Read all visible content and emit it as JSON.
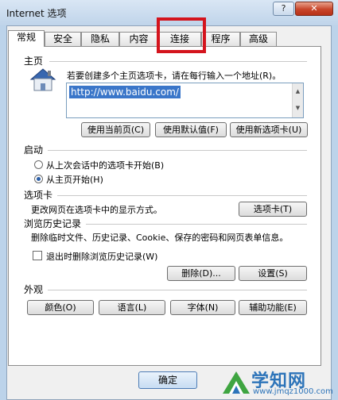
{
  "window": {
    "title": "Internet 选项",
    "help_label": "?",
    "close_label": "✕"
  },
  "tabs": [
    "常规",
    "安全",
    "隐私",
    "内容",
    "连接",
    "程序",
    "高级"
  ],
  "home": {
    "section": "主页",
    "desc": "若要创建多个主页选项卡，请在每行输入一个地址(R)。",
    "url": "http://www.baidu.com/",
    "btn_current": "使用当前页(C)",
    "btn_default": "使用默认值(F)",
    "btn_new_tab": "使用新选项卡(U)"
  },
  "startup": {
    "section": "启动",
    "opt_last_session": "从上次会话中的选项卡开始(B)",
    "opt_home": "从主页开始(H)",
    "selected": "opt_home"
  },
  "tab_settings": {
    "section": "选项卡",
    "desc": "更改网页在选项卡中的显示方式。",
    "btn": "选项卡(T)"
  },
  "history": {
    "section": "浏览历史记录",
    "desc": "删除临时文件、历史记录、Cookie、保存的密码和网页表单信息。",
    "checkbox_label": "退出时删除浏览历史记录(W)",
    "btn_delete": "删除(D)...",
    "btn_settings": "设置(S)"
  },
  "appearance": {
    "section": "外观",
    "btn_colors": "颜色(O)",
    "btn_languages": "语言(L)",
    "btn_fonts": "字体(N)",
    "btn_accessibility": "辅助功能(E)"
  },
  "footer": {
    "ok_label": "确定"
  },
  "watermark": {
    "title": "学知网",
    "url": "www.jmqz1000.com"
  }
}
